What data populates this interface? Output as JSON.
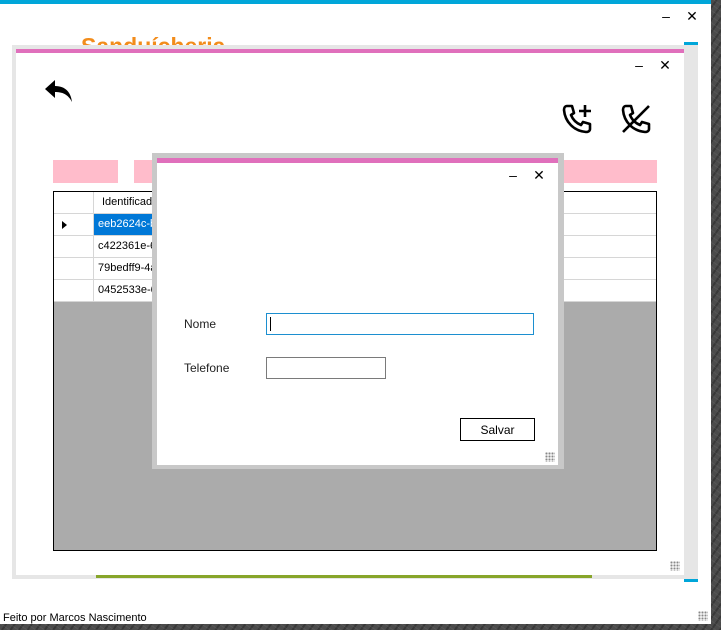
{
  "main_window": {
    "app_title": "Sanduícheria",
    "footer": "Feito por Marcos Nascimento",
    "minimize_glyph": "–",
    "close_glyph": "✕"
  },
  "contacts_window": {
    "minimize_glyph": "–",
    "close_glyph": "✕",
    "icons": [
      "back-arrow-icon",
      "phone-add-icon",
      "phone-off-icon"
    ],
    "grid": {
      "columns": [
        "Identificador"
      ],
      "rows": [
        {
          "id": "eeb2624c-bc"
        },
        {
          "id": "c422361e-65"
        },
        {
          "id": "79bedff9-4af"
        },
        {
          "id": "0452533e-6c"
        }
      ],
      "selected_row": 0
    }
  },
  "dialog": {
    "minimize_glyph": "–",
    "close_glyph": "✕",
    "nome_label": "Nome",
    "nome_value": "",
    "telefone_label": "Telefone",
    "telefone_value": "",
    "save_label": "Salvar"
  },
  "colors": {
    "title_bar_blue": "#00a6d9",
    "title_bar_pink": "#e070bc",
    "app_title_orange": "#f28c1b",
    "pink_block": "#ffbccb",
    "selection_blue": "#0078d7",
    "green_line": "#87a52a",
    "grid_background": "#ababab"
  }
}
